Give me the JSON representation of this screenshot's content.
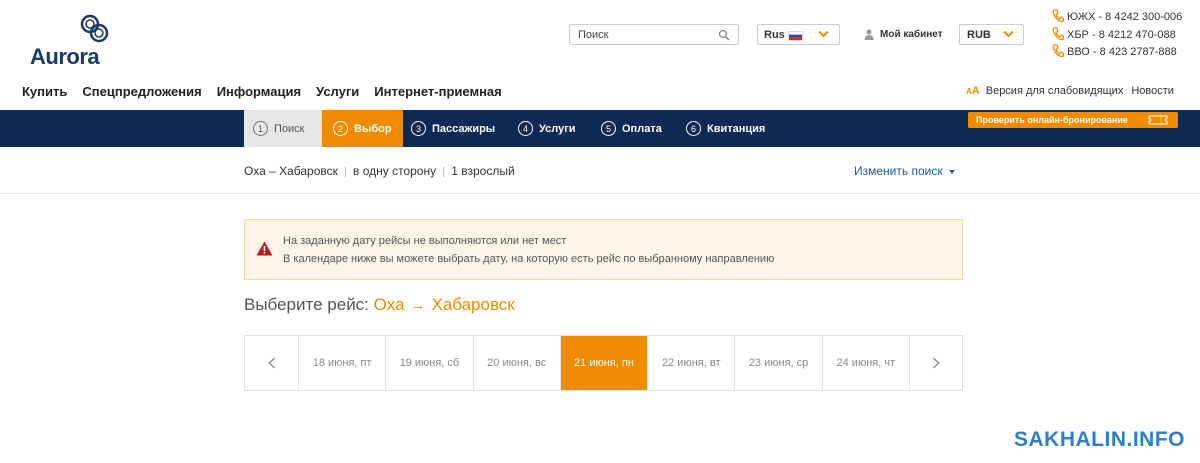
{
  "brand": {
    "logo_text": "Aurora"
  },
  "search": {
    "placeholder": "Поиск"
  },
  "language": {
    "selected": "Rus"
  },
  "cabinet": {
    "label": "Мой кабинет"
  },
  "currency": {
    "selected": "RUB"
  },
  "phones": [
    {
      "code": "ЮЖХ",
      "number": "8 4242 300-006"
    },
    {
      "code": "ХБР",
      "number": "8 4212 470-088"
    },
    {
      "code": "ВВО",
      "number": "8 423 2787-888"
    }
  ],
  "main_nav": [
    "Купить",
    "Спецпредложения",
    "Информация",
    "Услуги",
    "Интернет-приемная"
  ],
  "right_nav": {
    "accessibility": "Версия для слабовидящих",
    "news": "Новости"
  },
  "steps": [
    {
      "num": "1",
      "label": "Поиск",
      "state": "done"
    },
    {
      "num": "2",
      "label": "Выбор",
      "state": "active"
    },
    {
      "num": "3",
      "label": "Пассажиры",
      "state": "todo"
    },
    {
      "num": "4",
      "label": "Услуги",
      "state": "todo"
    },
    {
      "num": "5",
      "label": "Оплата",
      "state": "todo"
    },
    {
      "num": "6",
      "label": "Квитанция",
      "state": "todo"
    }
  ],
  "check_booking": "Проверить  онлайн-бронирование",
  "summary": {
    "route": "Оха – Хабаровск",
    "trip": "в одну сторону",
    "passengers": "1 взрослый",
    "change": "Изменить поиск"
  },
  "alert": {
    "line1": "На заданную дату рейсы не выполняются или нет мест",
    "line2": "В календаре ниже вы можете выбрать дату, на которую есть рейс по выбранному направлению"
  },
  "choose": {
    "prefix": "Выберите рейс:",
    "from": "Оха",
    "to": "Хабаровск"
  },
  "dates": [
    {
      "label": "18 июня, пт",
      "active": false
    },
    {
      "label": "19 июня, сб",
      "active": false
    },
    {
      "label": "20 июня, вс",
      "active": false
    },
    {
      "label": "21 июня, пн",
      "active": true
    },
    {
      "label": "22 июня, вт",
      "active": false
    },
    {
      "label": "23 июня, ср",
      "active": false
    },
    {
      "label": "24 июня, чт",
      "active": false
    }
  ],
  "watermark": "SAKHALIN.INFO",
  "colors": {
    "accent": "#f08a00",
    "navy": "#0d2a54",
    "link": "#1e5a9c"
  }
}
